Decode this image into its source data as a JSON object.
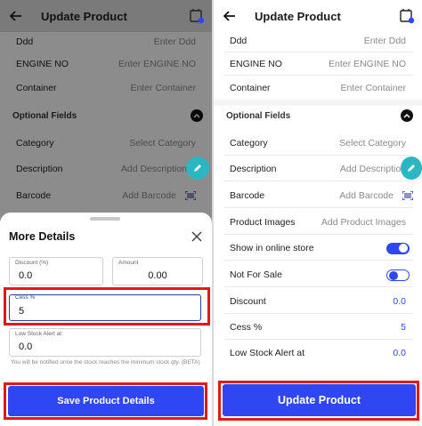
{
  "left": {
    "header": {
      "title": "Update Product"
    },
    "fields": [
      {
        "label": "Ddd",
        "placeholder": "Enter Ddd"
      },
      {
        "label": "ENGINE NO",
        "placeholder": "Enter ENGINE NO"
      },
      {
        "label": "Container",
        "placeholder": "Enter Container"
      }
    ],
    "optional_title": "Optional Fields",
    "optional": [
      {
        "label": "Category",
        "value": "Select Category"
      },
      {
        "label": "Description",
        "value": "Add Description"
      },
      {
        "label": "Barcode",
        "value": "Add Barcode"
      }
    ],
    "sheet": {
      "title": "More Details",
      "discount": {
        "label": "Discount (%)",
        "value": "0.0"
      },
      "amount": {
        "label": "Amount",
        "value": "0.00"
      },
      "cess": {
        "label": "Cess %",
        "value": "5"
      },
      "low_stock": {
        "label": "Low Stock Alert at",
        "value": "0.0"
      },
      "help": "You will be notified once the stock reaches the minimum stock qty. (BETA)",
      "save_label": "Save Product Details"
    }
  },
  "right": {
    "header": {
      "title": "Update Product"
    },
    "fields": [
      {
        "label": "Ddd",
        "placeholder": "Enter Ddd"
      },
      {
        "label": "ENGINE NO",
        "placeholder": "Enter ENGINE NO"
      },
      {
        "label": "Container",
        "placeholder": "Enter Container"
      }
    ],
    "optional_title": "Optional Fields",
    "optional": [
      {
        "label": "Category",
        "value": "Select Category"
      },
      {
        "label": "Description",
        "value": "Add Description"
      },
      {
        "label": "Barcode",
        "value": "Add Barcode"
      },
      {
        "label": "Product Images",
        "value": "Add Product Images"
      }
    ],
    "show_online": {
      "label": "Show in online store",
      "on": true
    },
    "not_for_sale": {
      "label": "Not For Sale",
      "on": false
    },
    "discount": {
      "label": "Discount",
      "value": "0.0"
    },
    "cess": {
      "label": "Cess %",
      "value": "5"
    },
    "low_stock": {
      "label": "Low Stock Alert at",
      "value": "0.0"
    },
    "update_label": "Update Product"
  },
  "colors": {
    "primary": "#2f47f2",
    "highlight": "#e01919",
    "fab": "#2bb6c4"
  }
}
